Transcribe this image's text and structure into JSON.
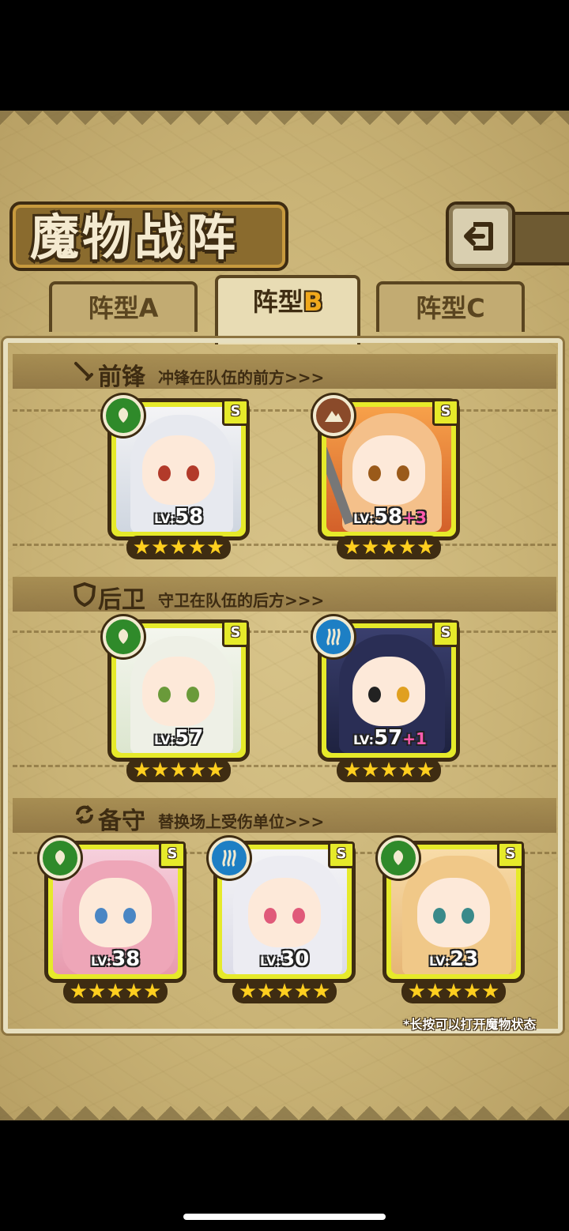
{
  "header": {
    "title": "魔物战阵",
    "back_icon": "back-arrow-icon"
  },
  "tabs": [
    {
      "prefix": "阵型",
      "suffix": "A",
      "active": false
    },
    {
      "prefix": "阵型",
      "suffix": "B",
      "active": true
    },
    {
      "prefix": "阵型",
      "suffix": "C",
      "active": false
    }
  ],
  "sections": {
    "vanguard": {
      "title": "前锋",
      "subtitle": "冲锋在队伍的前方>>>",
      "icon": "sword-icon"
    },
    "rearguard": {
      "title": "后卫",
      "subtitle": "守卫在队伍的后方>>>",
      "icon": "shield-icon"
    },
    "reserve": {
      "title": "备守",
      "subtitle": "替换场上受伤单位>>>",
      "icon": "swap-icon"
    }
  },
  "monsters": {
    "v1": {
      "level": "58",
      "bonus": "",
      "rank": "S",
      "element": "leaf-element-icon",
      "stars": 5
    },
    "v2": {
      "level": "58",
      "bonus": "+3",
      "rank": "S",
      "element": "earth-element-icon",
      "stars": 5
    },
    "r1": {
      "level": "57",
      "bonus": "",
      "rank": "S",
      "element": "leaf-element-icon",
      "stars": 5
    },
    "r2": {
      "level": "57",
      "bonus": "+1",
      "rank": "S",
      "element": "water-element-icon",
      "stars": 5
    },
    "b1": {
      "level": "38",
      "bonus": "",
      "rank": "S",
      "element": "leaf-element-icon",
      "stars": 5
    },
    "b2": {
      "level": "30",
      "bonus": "",
      "rank": "S",
      "element": "water-element-icon",
      "stars": 5
    },
    "b3": {
      "level": "23",
      "bonus": "",
      "rank": "S",
      "element": "leaf-element-icon",
      "stars": 5
    }
  },
  "level_prefix": "LV:",
  "star_glyph": "★★★★★",
  "hint": "*长按可以打开魔物状态",
  "colors": {
    "leaf": "#2f8a2a",
    "water": "#1d7fc4",
    "earth": "#8a4a2a",
    "card_frame": "#e6ea2a",
    "active_tab_letter": "#f0a81c"
  }
}
